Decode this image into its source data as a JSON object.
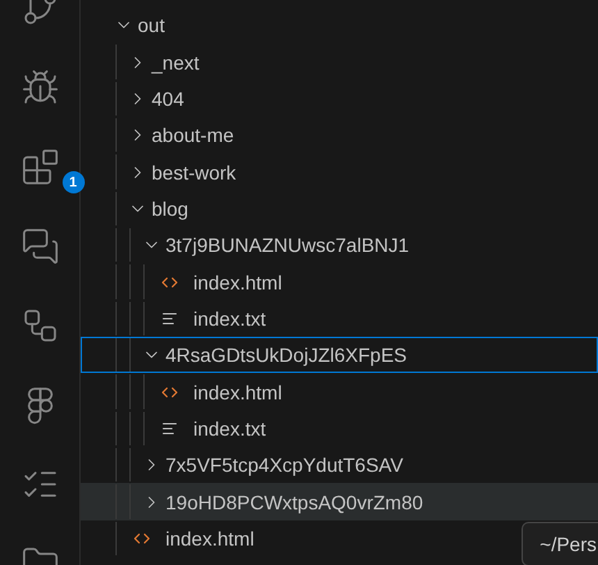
{
  "activity_bar": {
    "items": [
      {
        "kind": "source-control"
      },
      {
        "kind": "run-debug"
      },
      {
        "kind": "extensions",
        "badge": "1"
      },
      {
        "kind": "chat"
      },
      {
        "kind": "diagram"
      },
      {
        "kind": "figma"
      },
      {
        "kind": "checklist"
      },
      {
        "kind": "folder"
      }
    ]
  },
  "explorer": {
    "tree": [
      {
        "kind": "folder",
        "name": "out",
        "expanded": true,
        "selected": false,
        "hovered": false,
        "children": [
          {
            "kind": "folder",
            "name": "_next",
            "expanded": false,
            "selected": false,
            "hovered": false
          },
          {
            "kind": "folder",
            "name": "404",
            "expanded": false,
            "selected": false,
            "hovered": false
          },
          {
            "kind": "folder",
            "name": "about-me",
            "expanded": false,
            "selected": false,
            "hovered": false
          },
          {
            "kind": "folder",
            "name": "best-work",
            "expanded": false,
            "selected": false,
            "hovered": false
          },
          {
            "kind": "folder",
            "name": "blog",
            "expanded": true,
            "selected": false,
            "hovered": false,
            "children": [
              {
                "kind": "folder",
                "name": "3t7j9BUNAZNUwsc7alBNJ1",
                "expanded": true,
                "selected": false,
                "hovered": false,
                "children": [
                  {
                    "kind": "html",
                    "name": "index.html",
                    "selected": false,
                    "hovered": false
                  },
                  {
                    "kind": "txt",
                    "name": "index.txt",
                    "selected": false,
                    "hovered": false
                  }
                ]
              },
              {
                "kind": "folder",
                "name": "4RsaGDtsUkDojJZl6XFpES",
                "expanded": true,
                "selected": true,
                "hovered": false,
                "children": [
                  {
                    "kind": "html",
                    "name": "index.html",
                    "selected": false,
                    "hovered": false
                  },
                  {
                    "kind": "txt",
                    "name": "index.txt",
                    "selected": false,
                    "hovered": false
                  }
                ]
              },
              {
                "kind": "folder",
                "name": "7x5VF5tcp4XcpYdutT6SAV",
                "expanded": false,
                "selected": false,
                "hovered": false
              },
              {
                "kind": "folder",
                "name": "19oHD8PCWxtpsAQ0vrZm80",
                "expanded": false,
                "selected": false,
                "hovered": true
              }
            ]
          },
          {
            "kind": "html",
            "name": "index.html",
            "selected": false,
            "hovered": false
          }
        ]
      }
    ]
  },
  "tooltip": {
    "text": "~/Pers"
  }
}
